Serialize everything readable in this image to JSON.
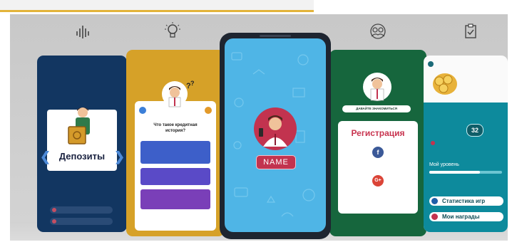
{
  "colors": {
    "navy": "#123661",
    "gold": "#d6a128",
    "sky": "#4fb5e6",
    "green": "#16663d",
    "teal": "#0d8a9c",
    "accent_red": "#c2334f"
  },
  "top_icons": [
    "bars-chart-icon",
    "lightbulb-icon",
    "users-icon",
    "clipboard-check-icon"
  ],
  "screens": {
    "deposits": {
      "title": "Депозиты"
    },
    "quiz": {
      "question": "Что такое кредитная история?",
      "answers_visible": 3
    },
    "profile": {
      "name_label": "NAME"
    },
    "registration": {
      "banner": "ДАВАЙТЕ ЗНАКОМИТЬСЯ",
      "title": "Регистрация"
    },
    "player": {
      "level": "32",
      "level_label": "Мой уровень",
      "progress": 0.7,
      "stats_button": "Статистика игр",
      "rewards_button": "Мои награды"
    }
  }
}
